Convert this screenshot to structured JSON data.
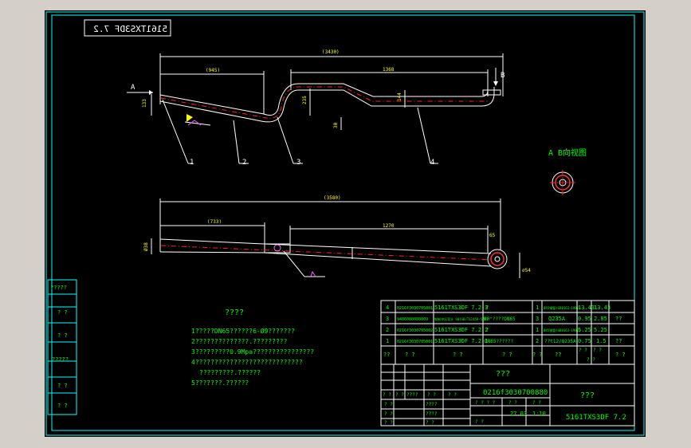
{
  "drawing": {
    "code_mirrored": "5161TXS3DF 7.2",
    "view_label": "A  B向视图",
    "arrow_a": "A",
    "arrow_b": "B",
    "dims_top": {
      "total": "(3430)",
      "left": "(945)",
      "right": "1368",
      "h1": "133",
      "h2": "235",
      "h3": "144",
      "h4": "30"
    },
    "dims_bottom": {
      "total": "(3580)",
      "left": "(733)",
      "right": "1270",
      "h1": "Ø38",
      "h2": "∅54",
      "h3": "65"
    },
    "balloons": [
      "1",
      "2",
      "3",
      "4"
    ]
  },
  "notes": {
    "title": "????",
    "lines": [
      "1?????DN65??????6-Ø9???????",
      "2??????????????.?????????",
      "3?????????0.9Mpa????????????????",
      "4????????????????????????????",
      "?????????.??????",
      "5???????.??????"
    ]
  },
  "left_strip": [
    "?????",
    "? ?",
    "? ?",
    "?????",
    "? ?",
    "? ?"
  ],
  "bom": {
    "rows": [
      {
        "no": "4",
        "code": "0216f3030705001",
        "name": "5161TXS3DF 7.2-3",
        "desc": "?",
        "qty": "1",
        "mat": "Ø45钢管(GB8163-1987)",
        "unit": "13.43",
        "total": "13.43",
        "note": ""
      },
      {
        "no": "3",
        "code": "9406000000009",
        "name": "钢制冲压弯头 90(GB/T12459-5MM)",
        "desc": "90°????DN65",
        "qty": "3",
        "mat": "Q235A",
        "unit": "0.95",
        "total": "2.85",
        "note": "??"
      },
      {
        "no": "2",
        "code": "0216f3030705002",
        "name": "5161TXS3DF 7.2-2",
        "desc": "?",
        "qty": "1",
        "mat": "Ø45钢管(GB8163-1987)",
        "unit": "5.25",
        "total": "5.25",
        "note": ""
      },
      {
        "no": "1",
        "code": "0216f3030705001",
        "name": "5161TXS3DF 7.2-1",
        "desc": "DN65??????",
        "qty": "2",
        "mat": "??t12/Q235A",
        "unit": "0.75",
        "total": "1.5",
        "note": "??"
      }
    ],
    "header": [
      "??",
      "? ?",
      "? ?",
      "? ?",
      "? ?",
      "??",
      "? ?",
      "? ?",
      "? ?",
      "? ?"
    ]
  },
  "title_block": {
    "name": "???",
    "drawing_no": "0216f3030700880",
    "company": "???",
    "code": "5161TXS3DF 7.2",
    "weight": "27.03",
    "scale": "1:10",
    "cells": [
      "? ?",
      "? ?",
      "????",
      "? ?",
      "? ?",
      "? ?",
      "????",
      "? ?",
      "????",
      "? ? ? ?",
      "? ?",
      "? ?",
      "? ?",
      "? ?",
      "? ?"
    ]
  }
}
